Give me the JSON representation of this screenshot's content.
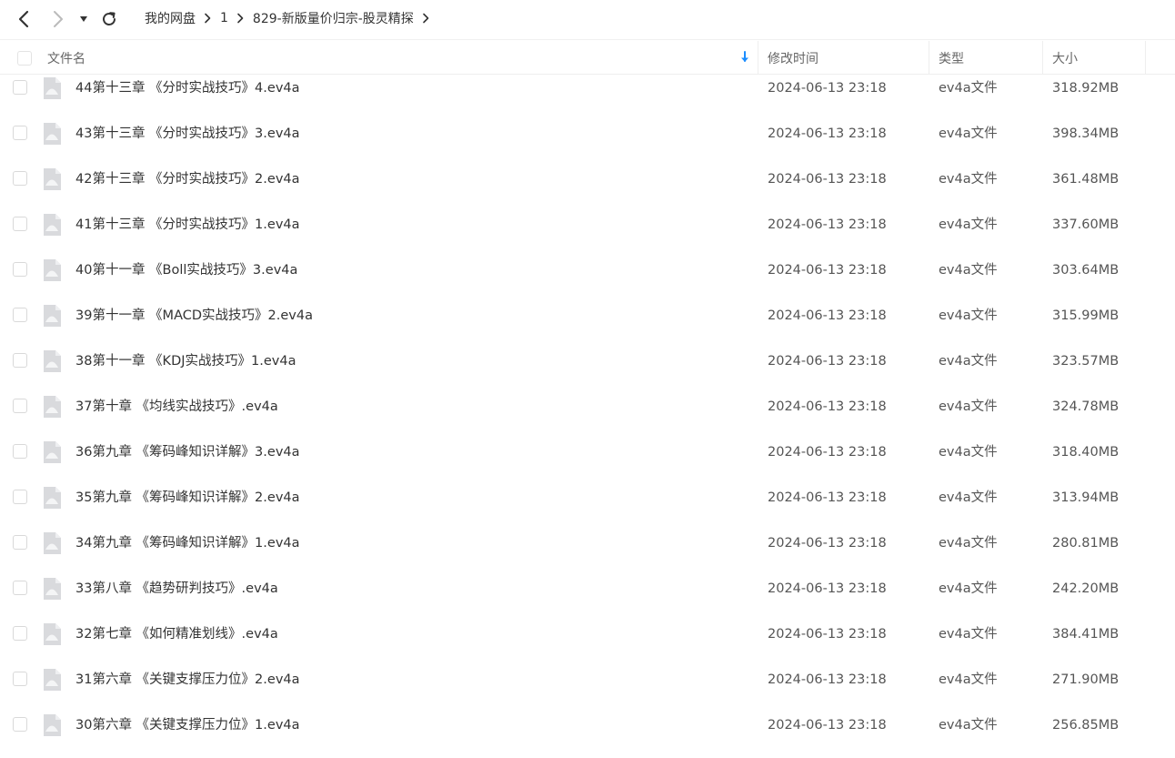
{
  "toolbar": {
    "back_icon": "chevron-left-icon",
    "forward_icon": "chevron-right-icon",
    "dropdown_icon": "caret-down-icon",
    "refresh_icon": "refresh-icon"
  },
  "breadcrumb": [
    "我的网盘",
    "1",
    "829-新版量价归宗-股灵精探"
  ],
  "columns": {
    "name": "文件名",
    "modified": "修改时间",
    "type": "类型",
    "size": "大小"
  },
  "colors": {
    "accent": "#1a8cff",
    "icon_gray": "#d9dadd"
  },
  "files": [
    {
      "name": "44第十三章 《分时实战技巧》4.ev4a",
      "modified": "2024-06-13 23:18",
      "type": "ev4a文件",
      "size": "318.92MB"
    },
    {
      "name": "43第十三章 《分时实战技巧》3.ev4a",
      "modified": "2024-06-13 23:18",
      "type": "ev4a文件",
      "size": "398.34MB"
    },
    {
      "name": "42第十三章 《分时实战技巧》2.ev4a",
      "modified": "2024-06-13 23:18",
      "type": "ev4a文件",
      "size": "361.48MB"
    },
    {
      "name": "41第十三章 《分时实战技巧》1.ev4a",
      "modified": "2024-06-13 23:18",
      "type": "ev4a文件",
      "size": "337.60MB"
    },
    {
      "name": "40第十一章 《Boll实战技巧》3.ev4a",
      "modified": "2024-06-13 23:18",
      "type": "ev4a文件",
      "size": "303.64MB"
    },
    {
      "name": "39第十一章 《MACD实战技巧》2.ev4a",
      "modified": "2024-06-13 23:18",
      "type": "ev4a文件",
      "size": "315.99MB"
    },
    {
      "name": "38第十一章 《KDJ实战技巧》1.ev4a",
      "modified": "2024-06-13 23:18",
      "type": "ev4a文件",
      "size": "323.57MB"
    },
    {
      "name": "37第十章 《均线实战技巧》.ev4a",
      "modified": "2024-06-13 23:18",
      "type": "ev4a文件",
      "size": "324.78MB"
    },
    {
      "name": "36第九章 《筹码峰知识详解》3.ev4a",
      "modified": "2024-06-13 23:18",
      "type": "ev4a文件",
      "size": "318.40MB"
    },
    {
      "name": "35第九章 《筹码峰知识详解》2.ev4a",
      "modified": "2024-06-13 23:18",
      "type": "ev4a文件",
      "size": "313.94MB"
    },
    {
      "name": "34第九章 《筹码峰知识详解》1.ev4a",
      "modified": "2024-06-13 23:18",
      "type": "ev4a文件",
      "size": "280.81MB"
    },
    {
      "name": "33第八章 《趋势研判技巧》.ev4a",
      "modified": "2024-06-13 23:18",
      "type": "ev4a文件",
      "size": "242.20MB"
    },
    {
      "name": "32第七章 《如何精准划线》.ev4a",
      "modified": "2024-06-13 23:18",
      "type": "ev4a文件",
      "size": "384.41MB"
    },
    {
      "name": "31第六章 《关键支撑压力位》2.ev4a",
      "modified": "2024-06-13 23:18",
      "type": "ev4a文件",
      "size": "271.90MB"
    },
    {
      "name": "30第六章 《关键支撑压力位》1.ev4a",
      "modified": "2024-06-13 23:18",
      "type": "ev4a文件",
      "size": "256.85MB"
    }
  ]
}
